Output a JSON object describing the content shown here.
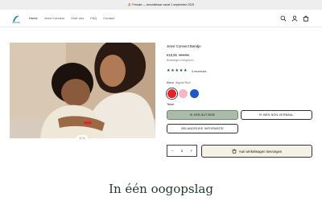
{
  "announcement": {
    "text": "🎉 Presale — beschikbaar vanaf 1 september 2025"
  },
  "header": {
    "nav": [
      "Home",
      "Jenvi Connect",
      "Over ons",
      "FAQ",
      "Contact"
    ],
    "icons": [
      "search-icon",
      "account-icon",
      "cart-icon"
    ]
  },
  "gallery": {
    "counter": "1 / 1"
  },
  "product": {
    "title": "Jenvi Connect Bandje",
    "price_sale": "€19,95",
    "price_compare": "€24,95",
    "tax_note": "Belastingen inbegrepen.",
    "rating_stars": 5,
    "reviews": "5 recensies",
    "color_label": "Kleur",
    "color_selected": "Signal Red",
    "colors": [
      {
        "name": "Signal Red",
        "hex": "#e32229"
      },
      {
        "name": "Pink",
        "hex": "#f2b8c8"
      },
      {
        "name": "Blue",
        "hex": "#1e57c7"
      }
    ],
    "text_label": "Tekst",
    "text_options": [
      "IK HEB AUTISME",
      "IK BEN NON-VERBAAL",
      "BELANGRIJKE INFORMATIE"
    ],
    "text_selected": "IK HEB AUTISME",
    "quantity": "1",
    "qty_minus": "−",
    "qty_plus": "+",
    "cart_button": "Aan winkelwagen toevoegen"
  },
  "section": {
    "title": "In één oogopslag"
  },
  "colors": {
    "selected_option_bg": "#a9bca9",
    "cart_bg": "#f5f1e6",
    "heading": "#1f3a2a",
    "stars": "#1d4d2a"
  }
}
